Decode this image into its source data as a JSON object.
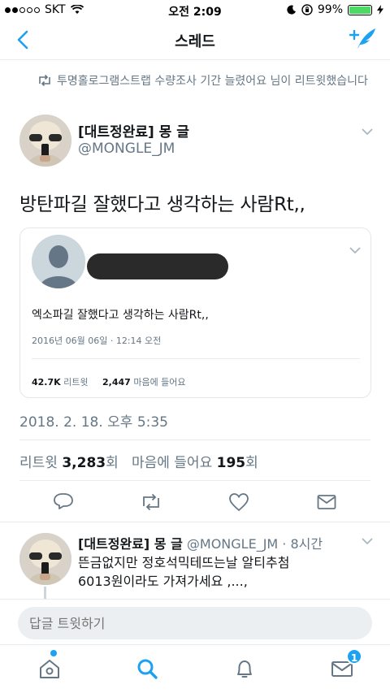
{
  "status_bar": {
    "carrier": "SKT",
    "time": "오전 2:09",
    "battery": "99%",
    "battery_level": 0.99
  },
  "nav": {
    "title": "스레드"
  },
  "retweet_context": {
    "text": "투명홀로그램스트랩 수량조사 기간 늘렸어요 님이 리트윗했습니다"
  },
  "tweet": {
    "author_name": "[대트정완료] 몽 글",
    "author_handle": "@MONGLE_JM",
    "text": "방탄파길 잘했다고 생각하는 사람Rt,,",
    "timestamp": "2018. 2. 18. 오후 5:35",
    "retweets_label": "리트윗",
    "retweets_count": "3,283",
    "retweets_suffix": "회",
    "likes_label": "마음에 들어요",
    "likes_count": "195",
    "likes_suffix": "회"
  },
  "quoted": {
    "text": "엑소파길 잘했다고 생각하는 사람Rt,,",
    "date": "2016년 06월 06일 · 12:14 오전",
    "retweets_count": "42.7K",
    "retweets_label": "리트윗",
    "likes_count": "2,447",
    "likes_label": "마음에 들어요"
  },
  "reply": {
    "author_name": "[대트정완료] 몽 글",
    "meta": "@MONGLE_JM · 8시간",
    "line1": "뜬금없지만 정호석믹테뜨는날 알티추첨",
    "line2": "6013원이라도 가져가세요 ,...,"
  },
  "compose": {
    "placeholder": "답글 트윗하기"
  },
  "tabbar": {
    "messages_badge": "1"
  },
  "colors": {
    "accent": "#1da1f2",
    "text_secondary": "#657786",
    "divider": "#e6ecf0"
  }
}
